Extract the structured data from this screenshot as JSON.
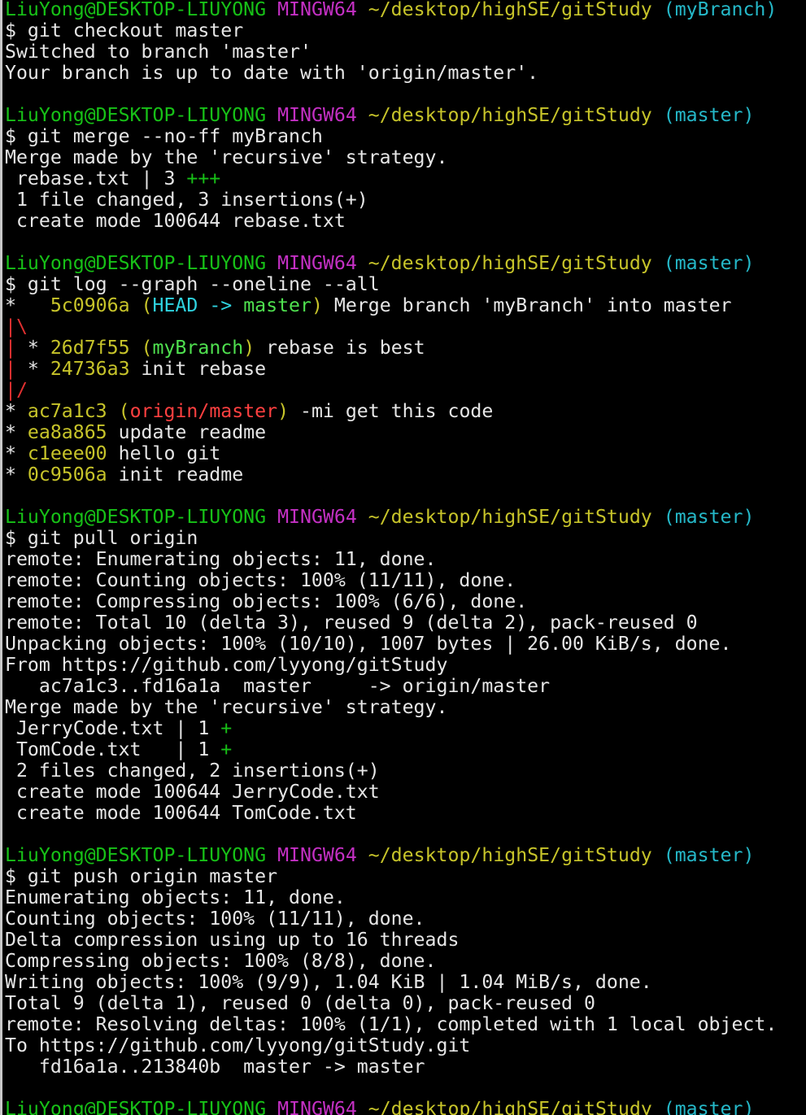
{
  "colors": {
    "background": "#000000",
    "text": "#e6e6e6",
    "user_host": "#17c117",
    "mingw": "#c430c4",
    "path": "#c7c42a",
    "branch": "#25b8c8",
    "diff_plus": "#17c117",
    "graph_red": "#e03030",
    "head_ref": "#2fd3e0",
    "local_branch_ref": "#4fe04f",
    "remote_ref": "#ff4040"
  },
  "lines": [
    {
      "type": "prompt",
      "user": "LiuYong@DESKTOP-LIUYONG",
      "system": "MINGW64",
      "path": "~/desktop/highSE/gitStudy",
      "branch": "(myBranch)"
    },
    {
      "type": "text",
      "text": "$ git checkout master"
    },
    {
      "type": "text",
      "text": "Switched to branch 'master'"
    },
    {
      "type": "text",
      "text": "Your branch is up to date with 'origin/master'."
    },
    {
      "type": "blank"
    },
    {
      "type": "prompt",
      "user": "LiuYong@DESKTOP-LIUYONG",
      "system": "MINGW64",
      "path": "~/desktop/highSE/gitStudy",
      "branch": "(master)"
    },
    {
      "type": "text",
      "text": "$ git merge --no-ff myBranch"
    },
    {
      "type": "text",
      "text": "Merge made by the 'recursive' strategy."
    },
    {
      "type": "diffstat",
      "text": " rebase.txt | 3 ",
      "plus": "+++"
    },
    {
      "type": "text",
      "text": " 1 file changed, 3 insertions(+)"
    },
    {
      "type": "text",
      "text": " create mode 100644 rebase.txt"
    },
    {
      "type": "blank"
    },
    {
      "type": "prompt",
      "user": "LiuYong@DESKTOP-LIUYONG",
      "system": "MINGW64",
      "path": "~/desktop/highSE/gitStudy",
      "branch": "(master)"
    },
    {
      "type": "text",
      "text": "$ git log --graph --oneline --all"
    },
    {
      "type": "commit",
      "graph": "*   ",
      "graph_color": "white",
      "hash": "5c0906a",
      "refs": [
        {
          "text": "HEAD -> ",
          "color": "bcyan"
        },
        {
          "text": "master",
          "color": "bgreen"
        }
      ],
      "message": " Merge branch 'myBranch' into master"
    },
    {
      "type": "graph",
      "parts": [
        {
          "text": "|\\",
          "color": "red"
        }
      ]
    },
    {
      "type": "commit",
      "graph_parts": [
        {
          "text": "| ",
          "color": "red"
        },
        {
          "text": "* ",
          "color": "white"
        }
      ],
      "hash": "26d7f55",
      "refs": [
        {
          "text": "myBranch",
          "color": "bgreen"
        }
      ],
      "message": " rebase is best"
    },
    {
      "type": "commit",
      "graph_parts": [
        {
          "text": "| ",
          "color": "red"
        },
        {
          "text": "* ",
          "color": "white"
        }
      ],
      "hash": "24736a3",
      "refs": [],
      "message": "init rebase"
    },
    {
      "type": "graph",
      "parts": [
        {
          "text": "|/",
          "color": "red"
        }
      ]
    },
    {
      "type": "commit",
      "graph_parts": [
        {
          "text": "* ",
          "color": "white"
        }
      ],
      "hash": "ac7a1c3",
      "refs": [
        {
          "text": "origin/master",
          "color": "bred"
        }
      ],
      "message": " -mi get this code"
    },
    {
      "type": "commit",
      "graph_parts": [
        {
          "text": "* ",
          "color": "white"
        }
      ],
      "hash": "ea8a865",
      "refs": [],
      "message": "update readme"
    },
    {
      "type": "commit",
      "graph_parts": [
        {
          "text": "* ",
          "color": "white"
        }
      ],
      "hash": "c1eee00",
      "refs": [],
      "message": "hello git"
    },
    {
      "type": "commit",
      "graph_parts": [
        {
          "text": "* ",
          "color": "white"
        }
      ],
      "hash": "0c9506a",
      "refs": [],
      "message": "init readme"
    },
    {
      "type": "blank"
    },
    {
      "type": "prompt",
      "user": "LiuYong@DESKTOP-LIUYONG",
      "system": "MINGW64",
      "path": "~/desktop/highSE/gitStudy",
      "branch": "(master)"
    },
    {
      "type": "text",
      "text": "$ git pull origin"
    },
    {
      "type": "text",
      "text": "remote: Enumerating objects: 11, done."
    },
    {
      "type": "text",
      "text": "remote: Counting objects: 100% (11/11), done."
    },
    {
      "type": "text",
      "text": "remote: Compressing objects: 100% (6/6), done."
    },
    {
      "type": "text",
      "text": "remote: Total 10 (delta 3), reused 9 (delta 2), pack-reused 0"
    },
    {
      "type": "text",
      "text": "Unpacking objects: 100% (10/10), 1007 bytes | 26.00 KiB/s, done."
    },
    {
      "type": "text",
      "text": "From https://github.com/lyyong/gitStudy"
    },
    {
      "type": "text",
      "text": "   ac7a1c3..fd16a1a  master     -> origin/master"
    },
    {
      "type": "text",
      "text": "Merge made by the 'recursive' strategy."
    },
    {
      "type": "diffstat",
      "text": " JerryCode.txt | 1 ",
      "plus": "+"
    },
    {
      "type": "diffstat",
      "text": " TomCode.txt   | 1 ",
      "plus": "+"
    },
    {
      "type": "text",
      "text": " 2 files changed, 2 insertions(+)"
    },
    {
      "type": "text",
      "text": " create mode 100644 JerryCode.txt"
    },
    {
      "type": "text",
      "text": " create mode 100644 TomCode.txt"
    },
    {
      "type": "blank"
    },
    {
      "type": "prompt",
      "user": "LiuYong@DESKTOP-LIUYONG",
      "system": "MINGW64",
      "path": "~/desktop/highSE/gitStudy",
      "branch": "(master)"
    },
    {
      "type": "text",
      "text": "$ git push origin master"
    },
    {
      "type": "text",
      "text": "Enumerating objects: 11, done."
    },
    {
      "type": "text",
      "text": "Counting objects: 100% (11/11), done."
    },
    {
      "type": "text",
      "text": "Delta compression using up to 16 threads"
    },
    {
      "type": "text",
      "text": "Compressing objects: 100% (8/8), done."
    },
    {
      "type": "text",
      "text": "Writing objects: 100% (9/9), 1.04 KiB | 1.04 MiB/s, done."
    },
    {
      "type": "text",
      "text": "Total 9 (delta 1), reused 0 (delta 0), pack-reused 0"
    },
    {
      "type": "text",
      "text": "remote: Resolving deltas: 100% (1/1), completed with 1 local object."
    },
    {
      "type": "text",
      "text": "To https://github.com/lyyong/gitStudy.git"
    },
    {
      "type": "text",
      "text": "   fd16a1a..213840b  master -> master"
    },
    {
      "type": "blank"
    },
    {
      "type": "prompt",
      "user": "LiuYong@DESKTOP-LIUYONG",
      "system": "MINGW64",
      "path": "~/desktop/highSE/gitStudy",
      "branch": "(master)"
    }
  ]
}
